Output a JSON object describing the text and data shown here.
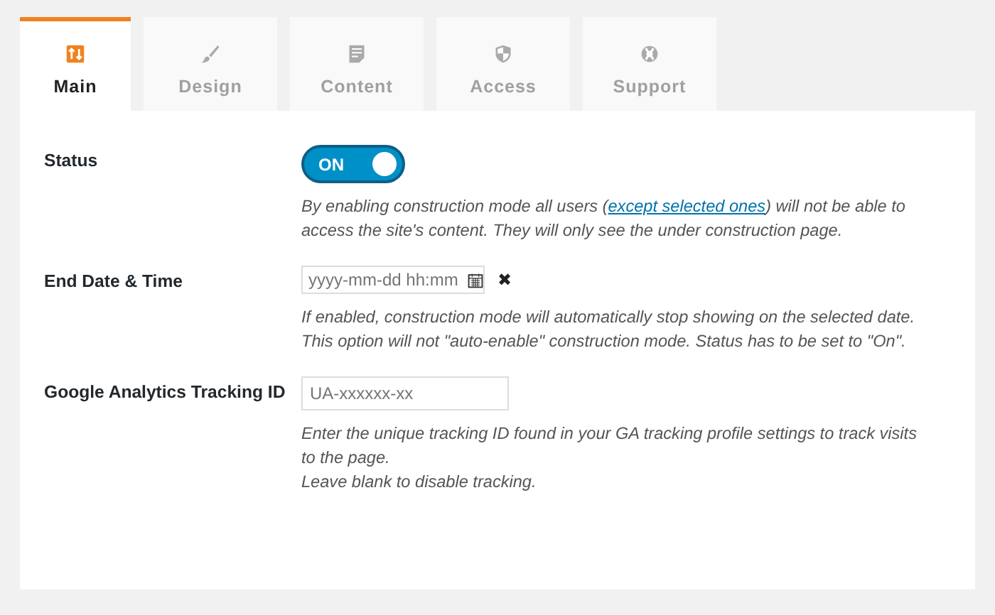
{
  "tabs": [
    {
      "label": "Main",
      "kind": "main",
      "selected": true
    },
    {
      "label": "Design",
      "kind": "brush",
      "selected": false
    },
    {
      "label": "Content",
      "kind": "document",
      "selected": false
    },
    {
      "label": "Access",
      "kind": "shield",
      "selected": false
    },
    {
      "label": "Support",
      "kind": "lifebuoy",
      "selected": false
    }
  ],
  "settings": [
    {
      "kind": "toggle",
      "label": "Status",
      "toggle": {
        "label": "ON",
        "on": true
      },
      "description": [
        {
          "before": "By enabling construction mode all users (",
          "link": "except selected ones",
          "after": ") will not be able to access the site's content. They will only see the under construction page."
        }
      ]
    },
    {
      "kind": "datetime",
      "label": "End Date & Time",
      "placeholder": "yyyy-mm-dd hh:mm",
      "clear": "✖",
      "description": [
        {
          "before": "If enabled, construction mode will automatically stop showing on the selected date."
        },
        {
          "before": "This option will not \"auto-enable\" construction mode. Status has to be set to \"On\"."
        }
      ]
    },
    {
      "kind": "text",
      "label": "Google Analytics Tracking ID",
      "placeholder": "UA-xxxxxx-xx",
      "description": [
        {
          "before": "Enter the unique tracking ID found in your GA tracking profile settings to track visits to the page."
        },
        {
          "before": "Leave blank to disable tracking."
        }
      ]
    }
  ]
}
